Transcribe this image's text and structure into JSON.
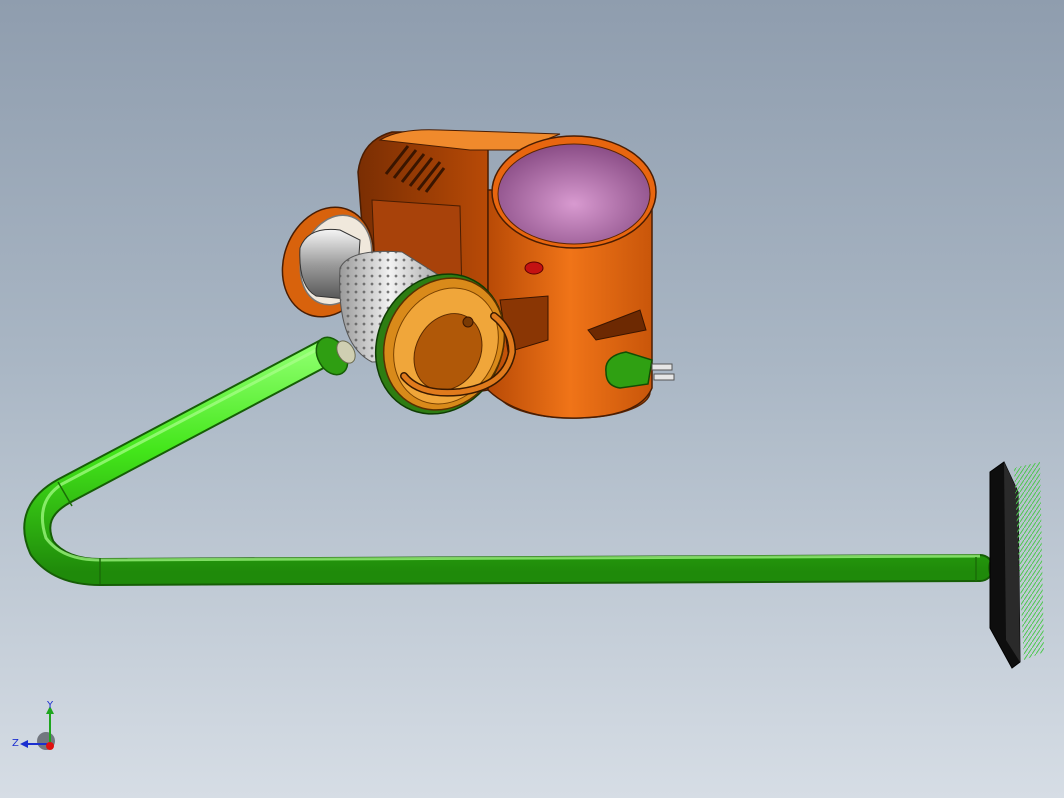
{
  "viewport": {
    "model": "vacuum-cleaner-assembly",
    "colors": {
      "background_top": "#8f9dae",
      "background_bottom": "#d6dde5",
      "body_orange": "#e8660f",
      "body_dark": "#9a3c05",
      "hose_green": "#43e61a",
      "hose_dark": "#1f8a0a",
      "bin_inner": "#b06ba8",
      "brush_black": "#111111",
      "bristles": "#4cc84c"
    }
  },
  "triad": {
    "x_label": "",
    "y_label": "Y",
    "z_label": "Z"
  }
}
